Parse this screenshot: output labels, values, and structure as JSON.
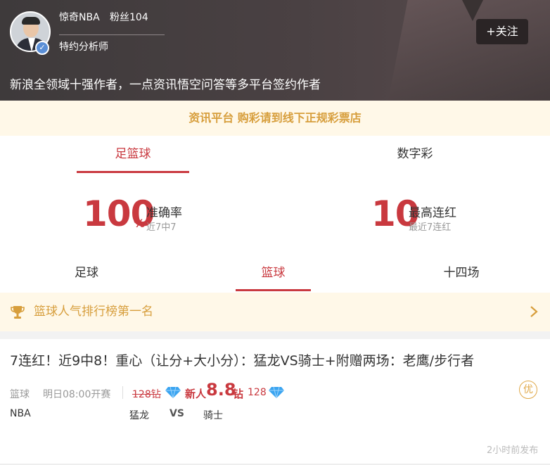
{
  "author": {
    "name": "惊奇NBA",
    "fans": "粉丝104",
    "role": "特约分析师",
    "follow_label": "+关注",
    "intro": "新浪全领域十强作者，一点资讯悟空问答等多平台签约作者"
  },
  "notice": "资讯平台 购彩请到线下正规彩票店",
  "category_tabs": [
    {
      "label": "足篮球",
      "active": true
    },
    {
      "label": "数字彩",
      "active": false
    }
  ],
  "stats": {
    "accuracy": {
      "value": "100",
      "unit": "%",
      "label": "准确率",
      "sub": "近7中7"
    },
    "streak": {
      "value": "10",
      "label": "最高连红",
      "sub": "最近7连红"
    }
  },
  "sub_tabs": [
    {
      "label": "足球",
      "active": false
    },
    {
      "label": "篮球",
      "active": true
    },
    {
      "label": "十四场",
      "active": false
    }
  ],
  "rank_banner": "篮球人气排行榜第一名",
  "article": {
    "title": "7连红！近9中8！重心（让分+大小分）：猛龙VS骑士+附赠两场：老鹰/步行者",
    "sport": "篮球",
    "time": "明日08:00开赛",
    "price_old": "128钻",
    "new_user_label": "新人",
    "new_price": "8.8",
    "new_price_unit": "钻",
    "price_current": "128",
    "badge": "优",
    "league": "NBA",
    "home": "猛龙",
    "vs": "VS",
    "away": "骑士",
    "published": "2小时前发布"
  },
  "colors": {
    "accent": "#c9393f",
    "gold": "#d79e3c",
    "notice_bg": "#fff8e8",
    "header_bg": "#3e3a3b",
    "diamond": "#3aa4f0"
  },
  "icons": [
    "verified-icon",
    "trophy-icon",
    "chevron-right-icon",
    "diamond-icon"
  ]
}
